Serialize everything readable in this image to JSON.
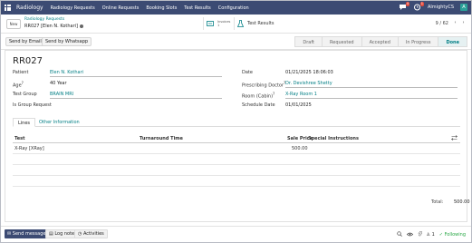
{
  "navbar": {
    "brand": "Radiology",
    "menu": [
      "Radiology Requests",
      "Online Requests",
      "Booking Slots",
      "Test Results",
      "Configuration"
    ],
    "company": "AlmightyCS",
    "avatar_letter": "A",
    "chat_badge": "4",
    "activity_badge": "1"
  },
  "control": {
    "new_label": "New",
    "breadcrumb_parent": "Radiology Requests",
    "breadcrumb_current": "RR027 [Elen N. Kothari]",
    "invoices_label": "Invoices",
    "invoices_count": "1",
    "test_results_label": "Test Results",
    "pager": "9 / 62"
  },
  "actions": {
    "send_email": "Send by Email",
    "send_whatsapp": "Send by Whatsapp"
  },
  "statusbar": {
    "stages": [
      "Draft",
      "Requested",
      "Accepted",
      "In Progress",
      "Done"
    ],
    "active": "Done"
  },
  "form": {
    "reference": "RR027",
    "left": [
      {
        "label": "Patient",
        "value": "Elen N. Kothari",
        "link": true
      },
      {
        "label": "Age",
        "value": "40 Year",
        "link": false
      },
      {
        "label": "Test Group",
        "value": "BRAIN MRI",
        "link": true
      },
      {
        "label": "Is Group Request",
        "value": "",
        "link": false
      }
    ],
    "right": [
      {
        "label": "Date",
        "value": "01/21/2025 18:06:03",
        "link": false
      },
      {
        "label": "Prescribing Doctor",
        "value": "Dr. Devishree Shetty",
        "link": true
      },
      {
        "label": "Room (Cabin)",
        "value": "X-Ray Room 1",
        "link": true
      },
      {
        "label": "Schedule Date",
        "value": "01/01/2025",
        "link": false
      }
    ]
  },
  "tabs": [
    "Lines",
    "Other Information"
  ],
  "lines_table": {
    "headers": [
      "Test",
      "Turnaround Time",
      "Sale Price",
      "Special Instructions"
    ],
    "rows": [
      {
        "test": "X-Ray [XRay]",
        "turnaround": "",
        "price": "500.00",
        "instructions": ""
      }
    ],
    "total_label": "Total:",
    "total_value": "500.00"
  },
  "chatter": {
    "send_message": "Send message",
    "log_note": "Log note",
    "activities": "Activities",
    "follower_count": "1",
    "following": "Following"
  },
  "colors": {
    "navbar": "#3c4b73",
    "accent": "#017e84",
    "following": "#28a745"
  }
}
